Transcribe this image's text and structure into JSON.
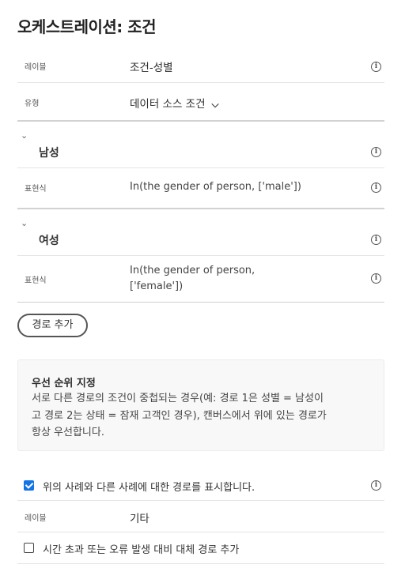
{
  "title": "오케스트레이션: 조건",
  "label_row": {
    "label": "레이블",
    "value": "조건-성별"
  },
  "type_row": {
    "label": "유형",
    "value": "데이터 소스 조건",
    "arrow": "⌄"
  },
  "paths": [
    {
      "name": "남성",
      "expr_label": "표현식",
      "expr": "In(the gender of person, ['male'])"
    },
    {
      "name": "여성",
      "expr_label": "표현식",
      "expr_line1": "In(the gender of person,",
      "expr_line2": "['female'])"
    }
  ],
  "add_path_button": "경로 추가",
  "priority": {
    "title": "우선 순위 지정",
    "line1": "서로 다른 경로의 조건이 중첩되는 경우(예: 경로 1은 성별 = 남성이",
    "line2": "고 경로 2는 상태 = 잠재 고객인 경우), 캔버스에서 위에 있는 경로가",
    "line3": "항상 우선합니다."
  },
  "show_other": {
    "label": "위의 사례와 다른 사례에 대한 경로를 표시합니다.",
    "checked": true
  },
  "other_label_row": {
    "label": "레이블",
    "value": "기타"
  },
  "timeout": {
    "label": "시간 초과 또는 오류 발생 대비 대체 경로 추가",
    "checked": false
  },
  "icons": {
    "info": "info-icon",
    "chevron": "chevron-down-icon"
  },
  "colors": {
    "accent": "#1473e6"
  }
}
